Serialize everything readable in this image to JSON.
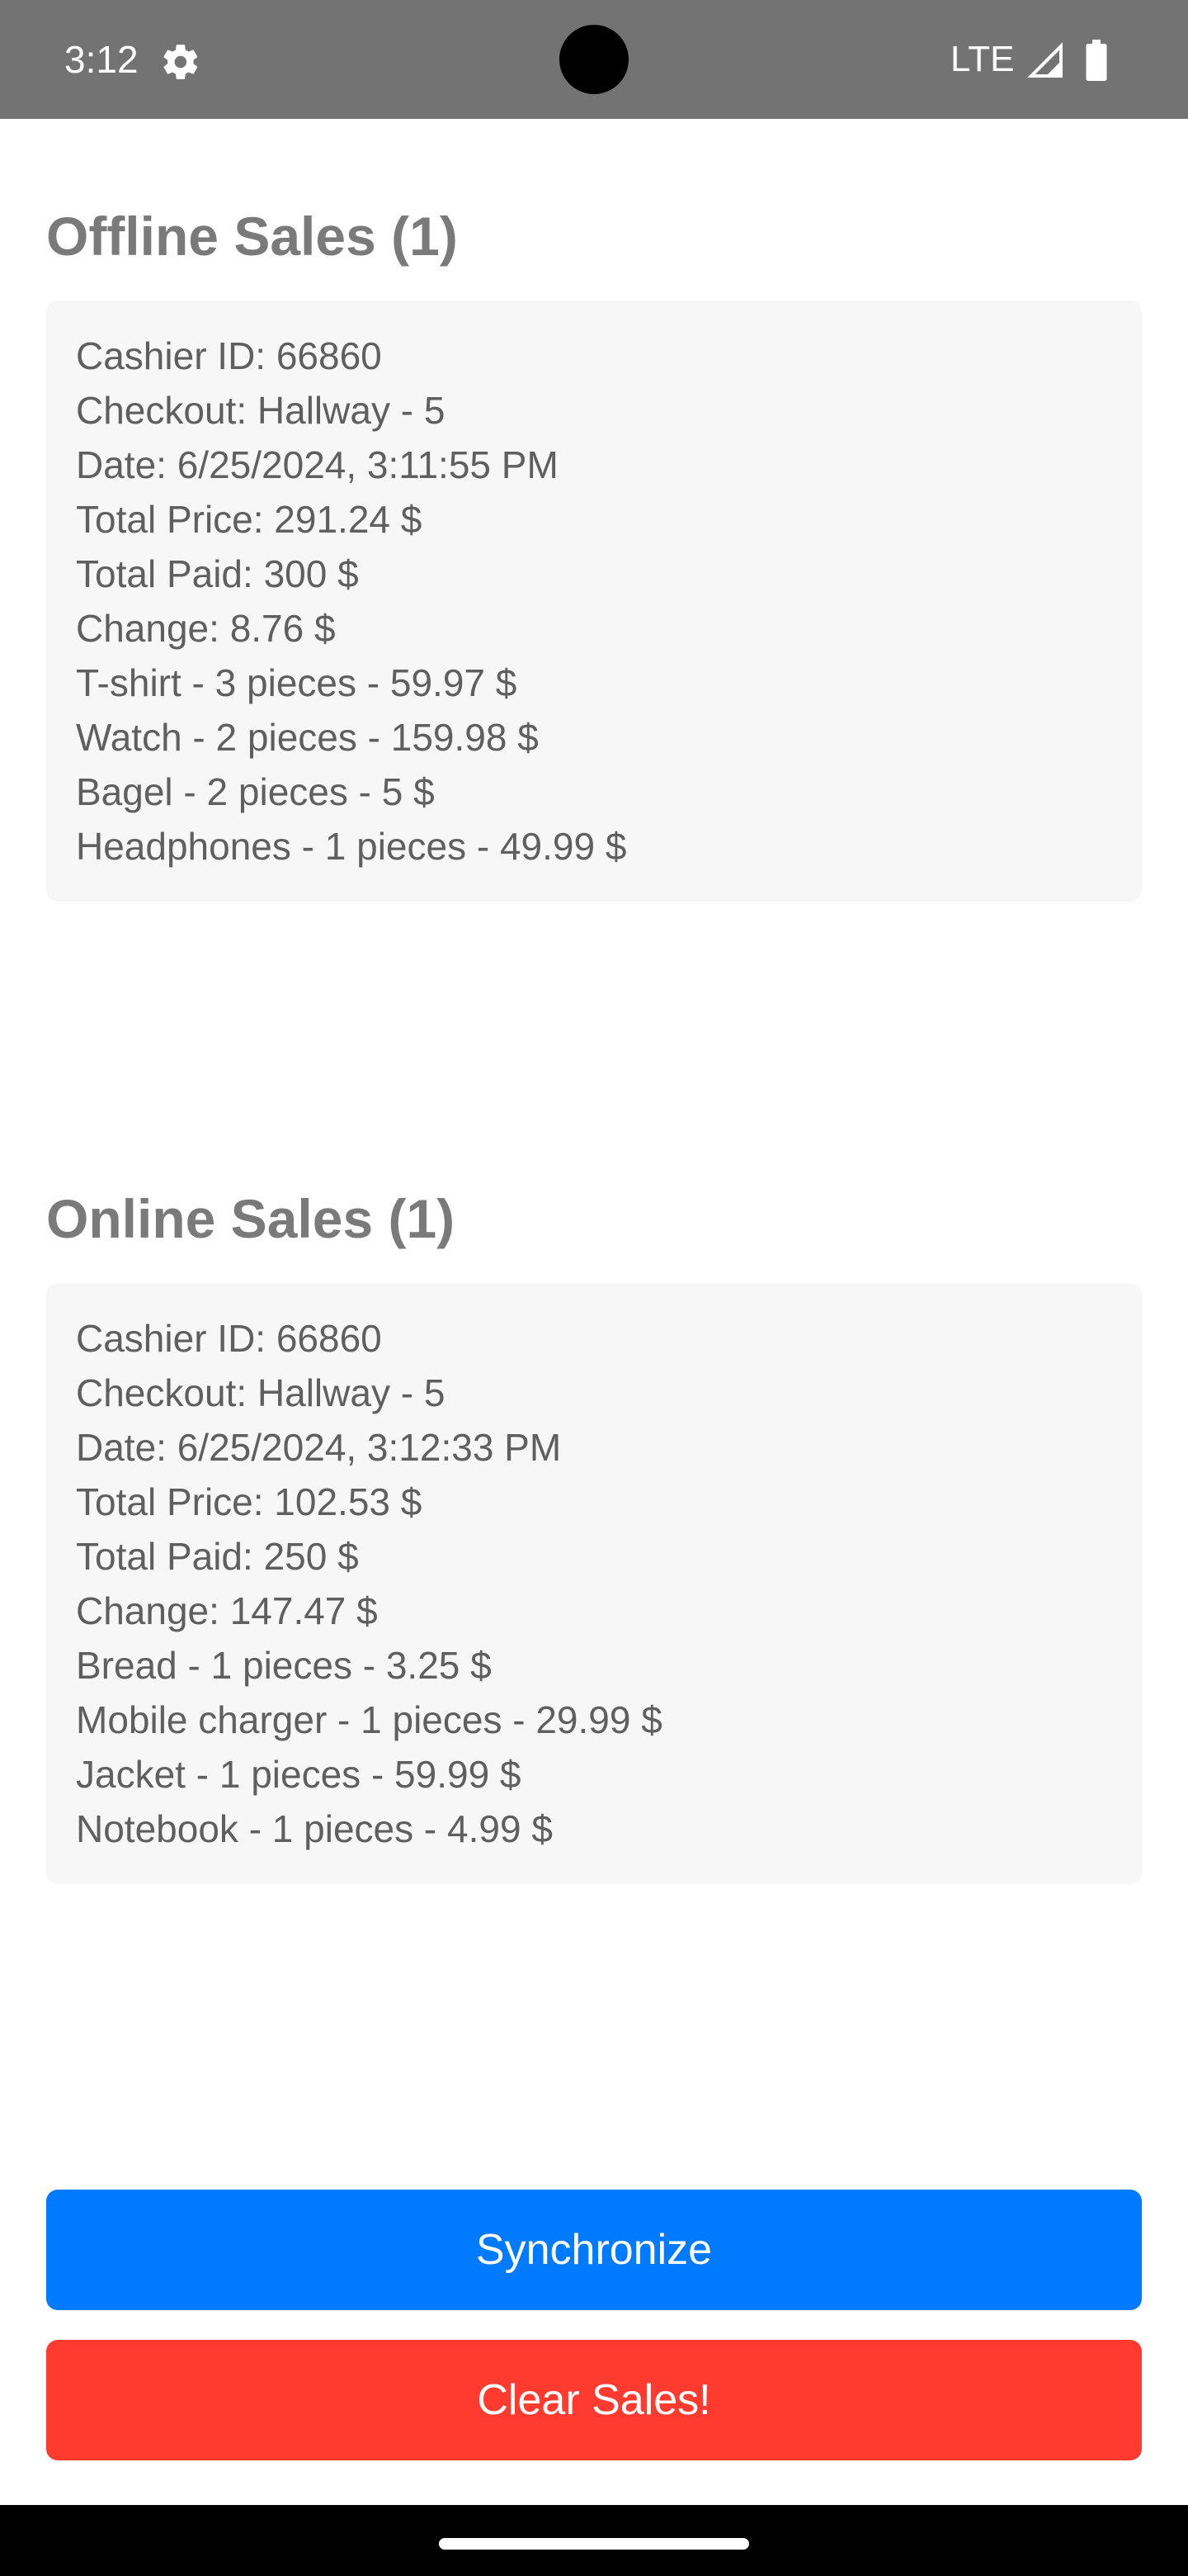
{
  "status_bar": {
    "time": "3:12",
    "network": "LTE"
  },
  "offline": {
    "title": "Offline Sales (1)",
    "sale": {
      "cashier": "Cashier ID: 66860",
      "checkout": "Checkout: Hallway - 5",
      "date": "Date: 6/25/2024, 3:11:55 PM",
      "total_price": "Total Price: 291.24 $",
      "total_paid": "Total Paid: 300 $",
      "change": "Change: 8.76 $",
      "items": [
        "T-shirt - 3 pieces - 59.97 $",
        "Watch - 2 pieces - 159.98 $",
        "Bagel - 2 pieces - 5 $",
        "Headphones - 1 pieces - 49.99 $"
      ]
    }
  },
  "online": {
    "title": "Online Sales (1)",
    "sale": {
      "cashier": "Cashier ID: 66860",
      "checkout": "Checkout: Hallway - 5",
      "date": "Date: 6/25/2024, 3:12:33 PM",
      "total_price": "Total Price: 102.53 $",
      "total_paid": "Total Paid: 250 $",
      "change": "Change: 147.47 $",
      "items": [
        "Bread - 1 pieces - 3.25 $",
        "Mobile charger - 1 pieces - 29.99 $",
        "Jacket - 1 pieces - 59.99 $",
        "Notebook - 1 pieces - 4.99 $"
      ]
    }
  },
  "buttons": {
    "synchronize": "Synchronize",
    "clear": "Clear Sales!"
  },
  "colors": {
    "synchronize": "#007aff",
    "clear": "#ff3b30"
  },
  "icons": {
    "settings": "gear-icon",
    "signal": "signal-icon",
    "battery": "battery-icon"
  }
}
